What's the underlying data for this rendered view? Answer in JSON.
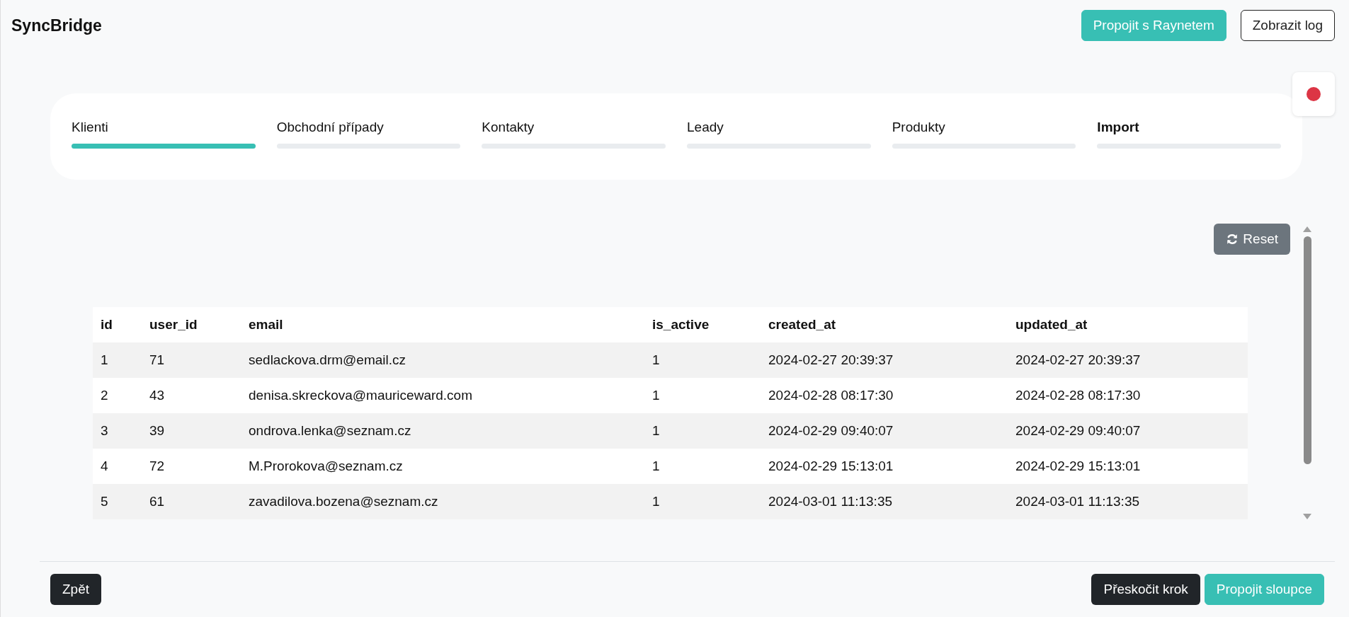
{
  "app_title": "SyncBridge",
  "header_buttons": [
    {
      "label": "Propojit s Raynetem",
      "kind": "primary"
    },
    {
      "label": "Zobrazit log",
      "kind": "outline"
    }
  ],
  "steps": [
    {
      "label": "Klienti",
      "selected": true,
      "emphasized": false
    },
    {
      "label": "Obchodní případy",
      "selected": false,
      "emphasized": false
    },
    {
      "label": "Kontakty",
      "selected": false,
      "emphasized": false
    },
    {
      "label": "Leady",
      "selected": false,
      "emphasized": false
    },
    {
      "label": "Produkty",
      "selected": false,
      "emphasized": false
    },
    {
      "label": "Import",
      "selected": false,
      "emphasized": true
    }
  ],
  "reset_button": "Reset",
  "table": {
    "columns": [
      "id",
      "user_id",
      "email",
      "is_active",
      "created_at",
      "updated_at"
    ],
    "rows": [
      [
        "1",
        "71",
        "sedlackova.drm@email.cz",
        "1",
        "2024-02-27 20:39:37",
        "2024-02-27 20:39:37"
      ],
      [
        "2",
        "43",
        "denisa.skreckova@mauriceward.com",
        "1",
        "2024-02-28 08:17:30",
        "2024-02-28 08:17:30"
      ],
      [
        "3",
        "39",
        "ondrova.lenka@seznam.cz",
        "1",
        "2024-02-29 09:40:07",
        "2024-02-29 09:40:07"
      ],
      [
        "4",
        "72",
        "M.Prorokova@seznam.cz",
        "1",
        "2024-02-29 15:13:01",
        "2024-02-29 15:13:01"
      ],
      [
        "5",
        "61",
        "zavadilova.bozena@seznam.cz",
        "1",
        "2024-03-01 11:13:35",
        "2024-03-01 11:13:35"
      ]
    ]
  },
  "footer": {
    "back_button": "Zpět",
    "buttons": [
      {
        "label": "Přeskočit krok",
        "kind": "dark"
      },
      {
        "label": "Propojit sloupce",
        "kind": "primary"
      }
    ]
  }
}
